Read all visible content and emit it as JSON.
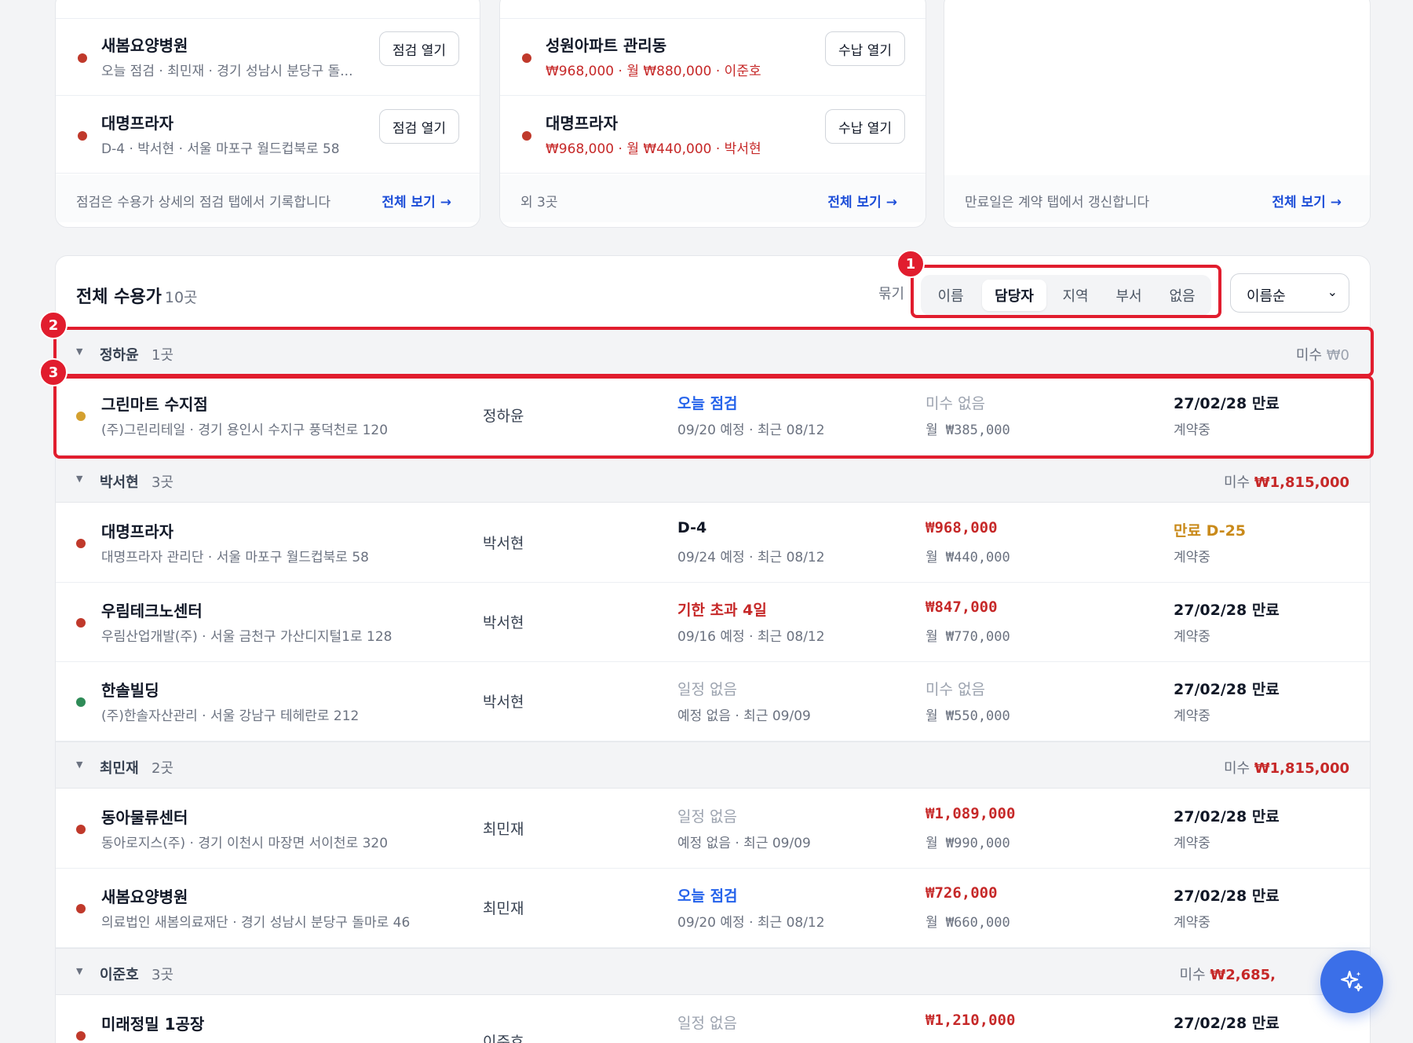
{
  "cards": {
    "inspection": {
      "items": [
        {
          "title": "새봄요양병원",
          "sub": "오늘 점검 · 최민재 · 경기 성남시 분당구 돌...",
          "button": "점검 열기",
          "status": "red"
        },
        {
          "title": "대명프라자",
          "sub": "D-4 · 박서현 · 서울 마포구 월드컵북로 58",
          "button": "점검 열기",
          "status": "red"
        }
      ],
      "note": "점검은 수용가 상세의 점검 탭에서 기록합니다",
      "link": "전체 보기 →"
    },
    "payment": {
      "items": [
        {
          "title": "성원아파트 관리동",
          "sub": "₩968,000 · 월 ₩880,000 · 이준호",
          "button": "수납 열기",
          "status": "red"
        },
        {
          "title": "대명프라자",
          "sub": "₩968,000 · 월 ₩440,000 · 박서현",
          "button": "수납 열기",
          "status": "red"
        }
      ],
      "note": "외 3곳",
      "link": "전체 보기 →"
    },
    "contract": {
      "note": "만료일은 계약 탭에서 갱신합니다",
      "link": "전체 보기 →"
    }
  },
  "list": {
    "title": "전체 수용가",
    "count": "10곳",
    "group_label": "묶기",
    "group_options": [
      "이름",
      "담당자",
      "지역",
      "부서",
      "없음"
    ],
    "group_active": "담당자",
    "sort_value": "이름순",
    "due_label": "미수",
    "groups": [
      {
        "name": "정하윤",
        "count": "1곳",
        "due": "₩0",
        "items": [
          {
            "name": "그린마트 수지점",
            "addr": "(주)그린리테일 · 경기 용인시 수지구 풍덕천로 120",
            "manager": "정하윤",
            "inspection": "오늘 점검",
            "inspection_detail": "09/20 예정 · 최근 08/12",
            "due": "미수 없음",
            "monthly": "월 ₩385,000",
            "contract": "27/02/28 만료",
            "contract_status": "계약중",
            "status": "amber"
          }
        ]
      },
      {
        "name": "박서현",
        "count": "3곳",
        "due": "₩1,815,000",
        "items": [
          {
            "name": "대명프라자",
            "addr": "대명프라자 관리단 · 서울 마포구 월드컵북로 58",
            "manager": "박서현",
            "inspection": "D-4",
            "inspection_detail": "09/24 예정 · 최근 08/12",
            "due": "₩968,000",
            "monthly": "월 ₩440,000",
            "contract": "만료 D-25",
            "contract_status": "계약중",
            "status": "red"
          },
          {
            "name": "우림테크노센터",
            "addr": "우림산업개발(주) · 서울 금천구 가산디지털1로 128",
            "manager": "박서현",
            "inspection": "기한 초과 4일",
            "inspection_detail": "09/16 예정 · 최근 08/12",
            "due": "₩847,000",
            "monthly": "월 ₩770,000",
            "contract": "27/02/28 만료",
            "contract_status": "계약중",
            "status": "red"
          },
          {
            "name": "한솔빌딩",
            "addr": "(주)한솔자산관리 · 서울 강남구 테헤란로 212",
            "manager": "박서현",
            "inspection": "일정 없음",
            "inspection_detail": "예정 없음 · 최근 09/09",
            "due": "미수 없음",
            "monthly": "월 ₩550,000",
            "contract": "27/02/28 만료",
            "contract_status": "계약중",
            "status": "green"
          }
        ]
      },
      {
        "name": "최민재",
        "count": "2곳",
        "due": "₩1,815,000",
        "items": [
          {
            "name": "동아물류센터",
            "addr": "동아로지스(주) · 경기 이천시 마장면 서이천로 320",
            "manager": "최민재",
            "inspection": "일정 없음",
            "inspection_detail": "예정 없음 · 최근 09/09",
            "due": "₩1,089,000",
            "monthly": "월 ₩990,000",
            "contract": "27/02/28 만료",
            "contract_status": "계약중",
            "status": "red"
          },
          {
            "name": "새봄요양병원",
            "addr": "의료법인 새봄의료재단 · 경기 성남시 분당구 돌마로 46",
            "manager": "최민재",
            "inspection": "오늘 점검",
            "inspection_detail": "09/20 예정 · 최근 08/12",
            "due": "₩726,000",
            "monthly": "월 ₩660,000",
            "contract": "27/02/28 만료",
            "contract_status": "계약중",
            "status": "red"
          }
        ]
      },
      {
        "name": "이준호",
        "count": "3곳",
        "due": "₩2,685,",
        "items": [
          {
            "name": "미래정밀 1공장",
            "manager": "이준호",
            "inspection": "일정 없음",
            "due": "₩1,210,000",
            "contract": "27/02/28 만료",
            "status": "red"
          }
        ]
      }
    ]
  },
  "annotations": [
    "1",
    "2",
    "3"
  ],
  "colors": {
    "accent": "#2563eb",
    "danger": "#c62828",
    "highlight": "#e11d2e",
    "fab": "#3b6fe8"
  },
  "icons": {
    "fab": "sparkle-icon",
    "sort": "chevron-down-icon",
    "group_caret": "caret-down-icon"
  }
}
